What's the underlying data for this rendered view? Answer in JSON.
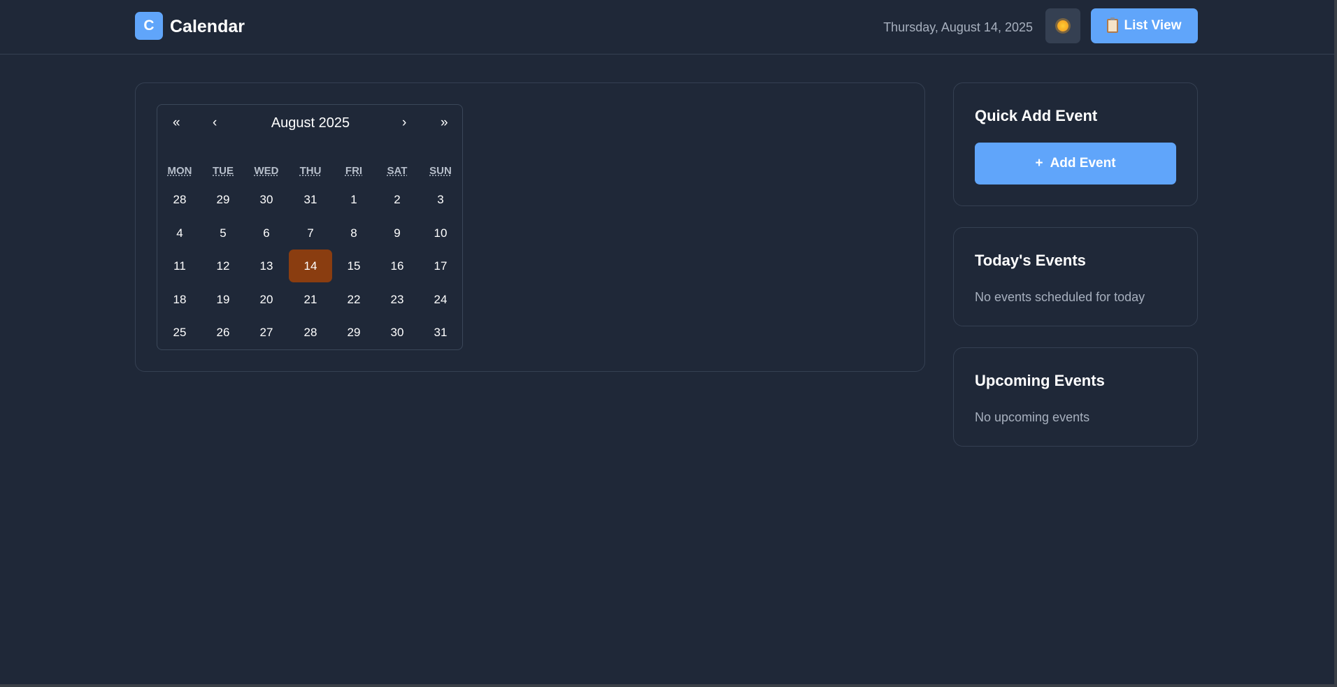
{
  "header": {
    "logo_letter": "C",
    "title": "Calendar",
    "date": "Thursday, August 14, 2025",
    "theme_icon": "sun-icon",
    "list_view_label": "List View",
    "list_view_icon": "clipboard-icon"
  },
  "calendar": {
    "nav": {
      "prev_year": "«",
      "prev_month": "‹",
      "next_month": "›",
      "next_year": "»"
    },
    "month_title": "August 2025",
    "weekdays": [
      "MON",
      "TUE",
      "WED",
      "THU",
      "FRI",
      "SAT",
      "SUN"
    ],
    "weeks": [
      [
        "28",
        "29",
        "30",
        "31",
        "1",
        "2",
        "3"
      ],
      [
        "4",
        "5",
        "6",
        "7",
        "8",
        "9",
        "10"
      ],
      [
        "11",
        "12",
        "13",
        "14",
        "15",
        "16",
        "17"
      ],
      [
        "18",
        "19",
        "20",
        "21",
        "22",
        "23",
        "24"
      ],
      [
        "25",
        "26",
        "27",
        "28",
        "29",
        "30",
        "31"
      ]
    ],
    "today": "14",
    "today_color": "#8a3d10"
  },
  "quick_add": {
    "title": "Quick Add Event",
    "button_icon": "+",
    "button_label": "Add Event"
  },
  "today_events": {
    "title": "Today's Events",
    "empty_text": "No events scheduled for today"
  },
  "upcoming_events": {
    "title": "Upcoming Events",
    "empty_text": "No upcoming events"
  },
  "colors": {
    "background": "#1f2838",
    "accent": "#60a5fa",
    "border": "#354052"
  }
}
